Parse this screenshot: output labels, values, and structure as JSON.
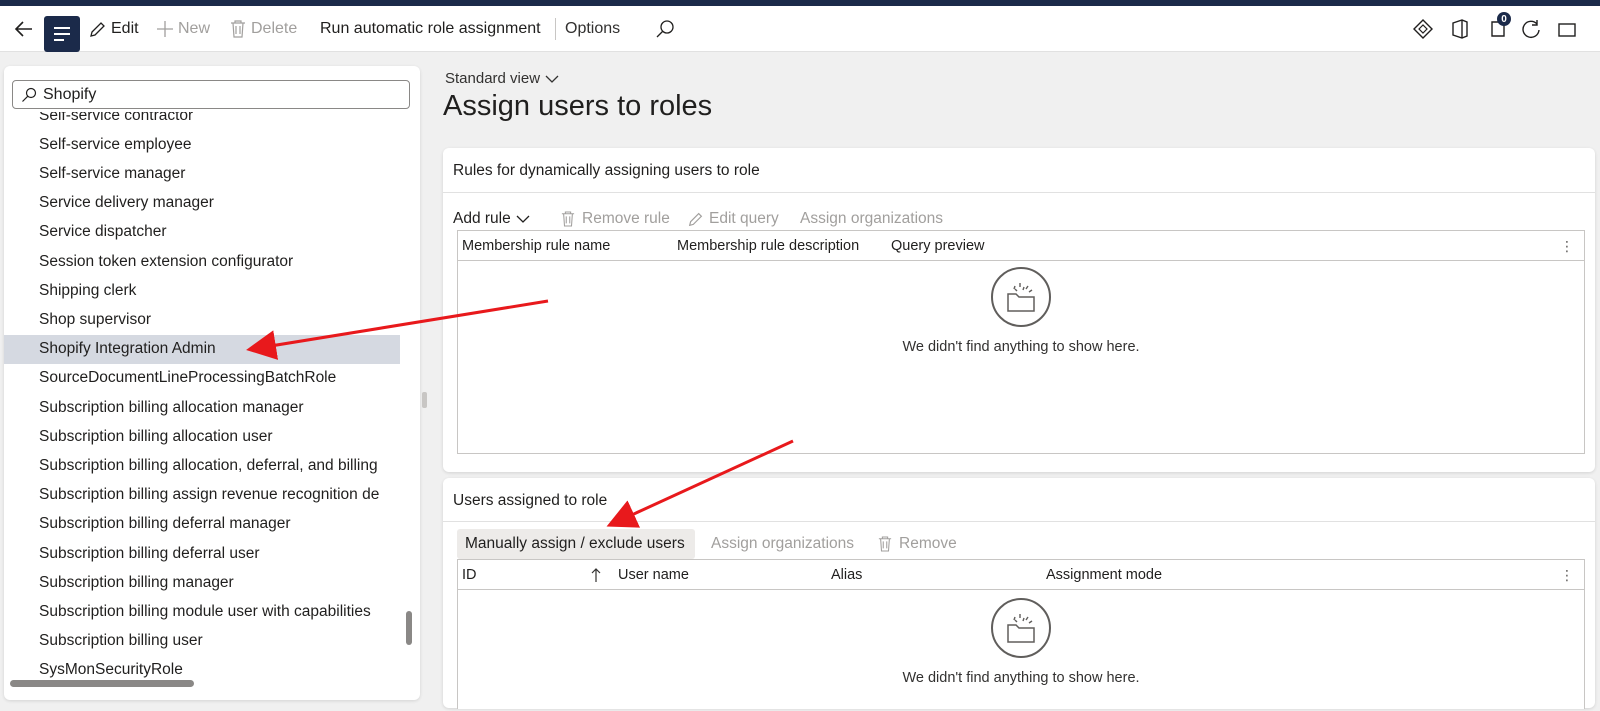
{
  "toolbar": {
    "edit": "Edit",
    "new": "New",
    "delete": "Delete",
    "run_assignment": "Run automatic role assignment",
    "options": "Options",
    "notification_count": "0"
  },
  "left_pane": {
    "search_value": "Shopify",
    "roles": [
      "Self-service contractor",
      "Self-service employee",
      "Self-service manager",
      "Service delivery manager",
      "Service dispatcher",
      "Session token extension configurator",
      "Shipping clerk",
      "Shop supervisor",
      "Shopify Integration Admin",
      "SourceDocumentLineProcessingBatchRole",
      "Subscription billing allocation manager",
      "Subscription billing allocation user",
      "Subscription billing allocation, deferral, and billing",
      "Subscription billing assign revenue recognition de",
      "Subscription billing deferral manager",
      "Subscription billing deferral user",
      "Subscription billing manager",
      "Subscription billing module user with capabilities",
      "Subscription billing user",
      "SysMonSecurityRole"
    ],
    "selected_index": 8
  },
  "main": {
    "view": "Standard view",
    "title": "Assign users to roles",
    "rules_section": {
      "title": "Rules for dynamically assigning users to role",
      "add_rule": "Add rule",
      "remove_rule": "Remove rule",
      "edit_query": "Edit query",
      "assign_orgs": "Assign organizations",
      "columns": [
        "Membership rule name",
        "Membership rule description",
        "Query preview"
      ],
      "empty_text": "We didn't find anything to show here."
    },
    "users_section": {
      "title": "Users assigned to role",
      "manual_assign": "Manually assign / exclude users",
      "assign_orgs": "Assign organizations",
      "remove": "Remove",
      "columns": [
        "ID",
        "User name",
        "Alias",
        "Assignment mode"
      ],
      "empty_text": "We didn't find anything to show here."
    }
  },
  "colors": {
    "nav_dark": "#1b2a4a",
    "selected_row": "#d5d9e1",
    "annotation_arrow": "#e8191c"
  }
}
